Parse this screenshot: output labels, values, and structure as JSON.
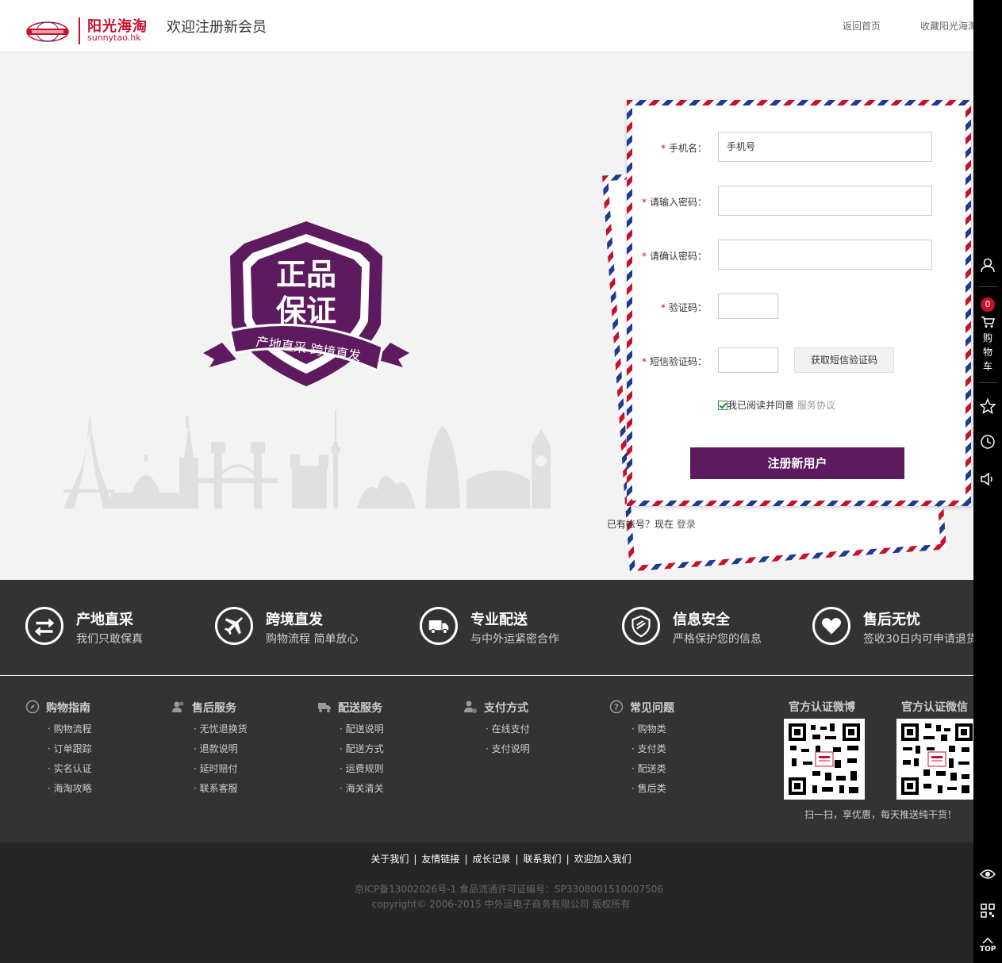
{
  "header": {
    "logo_cn": "阳光海淘",
    "logo_en": "sunnytao.hk",
    "title": "欢迎注册新会员",
    "nav": {
      "home": "返回首页",
      "favorite": "收藏阳光海淘"
    }
  },
  "badge": {
    "line1": "正品",
    "line2": "保证",
    "ribbon": "产地直采  跨境直发"
  },
  "form": {
    "phone_label": "手机名：",
    "phone_value": "手机号",
    "password_label": "请输入密码：",
    "confirm_label": "请确认密码：",
    "captcha_label": "验证码：",
    "sms_label": "短信验证码：",
    "sms_button": "获取短信验证码",
    "agree_text": "我已阅读并同意",
    "agree_link": "服务协议",
    "submit": "注册新用户"
  },
  "login_prompt": {
    "text": "已有帐号？现在",
    "link": "登录"
  },
  "features": [
    {
      "title": "产地直采",
      "subtitle": "我们只敢保真",
      "icon": "exchange-arrows-icon"
    },
    {
      "title": "跨境直发",
      "subtitle": "购物流程 简单放心",
      "icon": "airplane-icon"
    },
    {
      "title": "专业配送",
      "subtitle": "与中外运紧密合作",
      "icon": "delivery-truck-icon"
    },
    {
      "title": "信息安全",
      "subtitle": "严格保护您的信息",
      "icon": "security-shield-icon"
    },
    {
      "title": "售后无忧",
      "subtitle": "签收30日内可申请退货",
      "icon": "heart-icon"
    }
  ],
  "footer_links": [
    {
      "title": "购物指南",
      "icon": "compass-icon",
      "items": [
        "购物流程",
        "订单跟踪",
        "实名认证",
        "海淘攻略"
      ]
    },
    {
      "title": "售后服务",
      "icon": "users-icon",
      "items": [
        "无忧退换货",
        "退款说明",
        "延时赔付",
        "联系客服"
      ]
    },
    {
      "title": "配送服务",
      "icon": "truck-icon",
      "items": [
        "配送说明",
        "配送方式",
        "运费规则",
        "海关清关"
      ]
    },
    {
      "title": "支付方式",
      "icon": "user-pay-icon",
      "items": [
        "在线支付",
        "支付说明"
      ]
    },
    {
      "title": "常见问题",
      "icon": "question-icon",
      "items": [
        "购物类",
        "支付类",
        "配送类",
        "售后类"
      ]
    }
  ],
  "qr": {
    "weibo_title": "官方认证微博",
    "wechat_title": "官方认证微信",
    "caption": "扫一扫，享优惠，每天推送纯干货！"
  },
  "bottom": {
    "links": [
      "关于我们",
      "友情链接",
      "成长记录",
      "联系我们",
      "欢迎加入我们"
    ],
    "icp": "京ICP备13002026号-1   食品流通许可证编号：SP3308001510007506",
    "copyright": "copyright© 2006-2015 中外运电子商务有限公司  版权所有"
  },
  "sidebar": {
    "cart_count": "0",
    "cart_label": "购物车",
    "top_label": "TOP"
  },
  "colors": {
    "brand_red": "#c8102e",
    "primary_purple": "#5e1a5e",
    "footer_dark": "#333333",
    "sidebar_black": "#000000"
  }
}
